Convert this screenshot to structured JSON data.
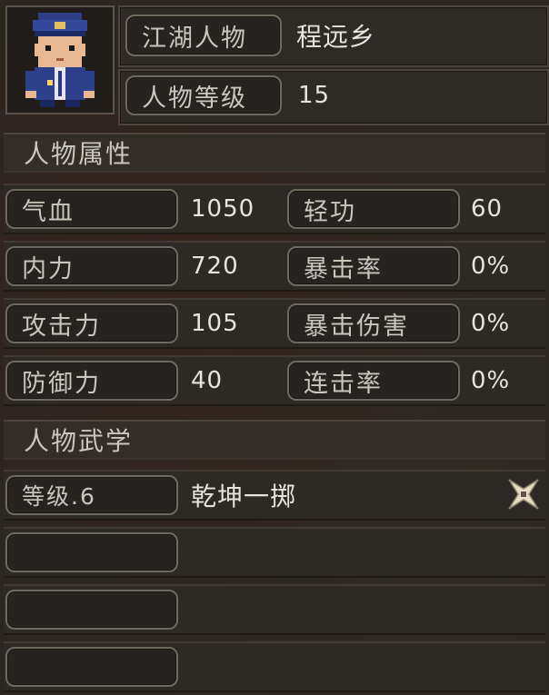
{
  "profile": {
    "name_label": "江湖人物",
    "name_value": "程远乡",
    "level_label": "人物等级",
    "level_value": "15"
  },
  "attributes": {
    "section_title": "人物属性",
    "rows": [
      {
        "left_label": "气血",
        "left_value": "1050",
        "right_label": "轻功",
        "right_value": "60"
      },
      {
        "left_label": "内力",
        "left_value": "720",
        "right_label": "暴击率",
        "right_value": "0%"
      },
      {
        "left_label": "攻击力",
        "left_value": "105",
        "right_label": "暴击伤害",
        "right_value": "0%"
      },
      {
        "left_label": "防御力",
        "left_value": "40",
        "right_label": "连击率",
        "right_value": "0%"
      }
    ]
  },
  "martial": {
    "section_title": "人物武学",
    "skills": [
      {
        "level_label": "等级.6",
        "name": "乾坤一掷",
        "icon": "shuriken-icon"
      },
      {
        "level_label": "",
        "name": ""
      },
      {
        "level_label": "",
        "name": ""
      },
      {
        "level_label": "",
        "name": ""
      }
    ]
  }
}
